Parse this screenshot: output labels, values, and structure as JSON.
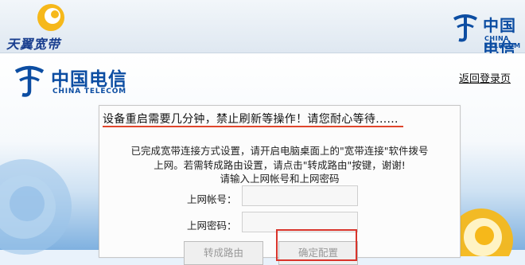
{
  "brand": {
    "tianyi": "天翼宽带",
    "telecom_cn": "中国电信",
    "telecom_en": "CHINA TELECOM"
  },
  "header": {
    "logout_label": "返回登录页"
  },
  "panel": {
    "notice": "设备重启需要几分钟，禁止刷新等操作！请您耐心等待......",
    "desc_line1": "已完成宽带连接方式设置，请开启电脑桌面上的\"宽带连接\"软件拨号",
    "desc_line2": "上网。若需转成路由设置，请点击\"转成路由\"按键，谢谢!",
    "desc_line3": "请输入上网帐号和上网密码",
    "account_label": "上网帐号：",
    "password_label": "上网密码：",
    "account_value": "",
    "password_value": "",
    "switch_router_label": "转成路由",
    "confirm_label": "确定配置"
  },
  "colors": {
    "brand_blue": "#0c4da2",
    "highlight_red": "#d9342b",
    "notice_underline": "#e0452c"
  }
}
